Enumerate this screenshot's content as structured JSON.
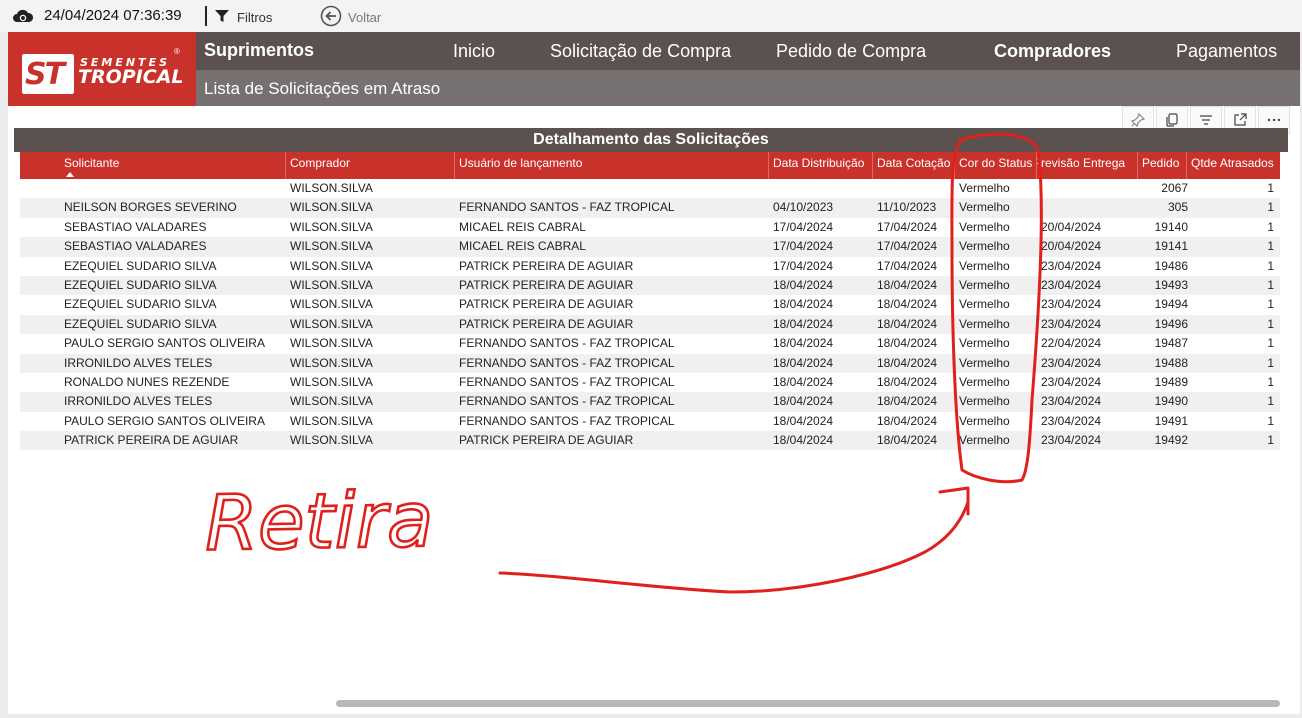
{
  "topbar": {
    "timestamp": "24/04/2024 07:36:39",
    "filters_label": "Filtros",
    "back_label": "Voltar"
  },
  "header": {
    "logo_top": "SEMENTES",
    "logo_bottom": "TROPICAL",
    "logo_mark": "ST",
    "section": "Suprimentos",
    "page_subtitle": "Lista de Solicitações em Atraso",
    "nav": [
      {
        "label": "Inicio",
        "active": false
      },
      {
        "label": "Solicitação de Compra",
        "active": false
      },
      {
        "label": "Pedido de Compra",
        "active": false
      },
      {
        "label": "Compradores",
        "active": true
      },
      {
        "label": "Pagamentos",
        "active": false
      }
    ]
  },
  "table": {
    "title": "Detalhamento das Solicitações",
    "columns": [
      "Solicitante",
      "Comprador",
      "Usuário de lançamento",
      "Data Distribuição",
      "Data Cotação",
      "Cor do Status",
      "Previsão Entrega",
      "Pedido",
      "Qtde Atrasados"
    ],
    "rows": [
      [
        "",
        "WILSON.SILVA",
        "",
        "",
        "",
        "Vermelho",
        "",
        "2067",
        "1"
      ],
      [
        "NEILSON BORGES SEVERINO",
        "WILSON.SILVA",
        "FERNANDO SANTOS - FAZ TROPICAL",
        "04/10/2023",
        "11/10/2023",
        "Vermelho",
        "",
        "305",
        "1"
      ],
      [
        "SEBASTIAO VALADARES",
        "WILSON.SILVA",
        "MICAEL REIS CABRAL",
        "17/04/2024",
        "17/04/2024",
        "Vermelho",
        "20/04/2024",
        "19140",
        "1"
      ],
      [
        "SEBASTIAO VALADARES",
        "WILSON.SILVA",
        "MICAEL REIS CABRAL",
        "17/04/2024",
        "17/04/2024",
        "Vermelho",
        "20/04/2024",
        "19141",
        "1"
      ],
      [
        "EZEQUIEL SUDARIO SILVA",
        "WILSON.SILVA",
        "PATRICK PEREIRA DE AGUIAR",
        "17/04/2024",
        "17/04/2024",
        "Vermelho",
        "23/04/2024",
        "19486",
        "1"
      ],
      [
        "EZEQUIEL SUDARIO SILVA",
        "WILSON.SILVA",
        "PATRICK PEREIRA DE AGUIAR",
        "18/04/2024",
        "18/04/2024",
        "Vermelho",
        "23/04/2024",
        "19493",
        "1"
      ],
      [
        "EZEQUIEL SUDARIO SILVA",
        "WILSON.SILVA",
        "PATRICK PEREIRA DE AGUIAR",
        "18/04/2024",
        "18/04/2024",
        "Vermelho",
        "23/04/2024",
        "19494",
        "1"
      ],
      [
        "EZEQUIEL SUDARIO SILVA",
        "WILSON.SILVA",
        "PATRICK PEREIRA DE AGUIAR",
        "18/04/2024",
        "18/04/2024",
        "Vermelho",
        "23/04/2024",
        "19496",
        "1"
      ],
      [
        "PAULO SERGIO SANTOS OLIVEIRA",
        "WILSON.SILVA",
        "FERNANDO SANTOS - FAZ TROPICAL",
        "18/04/2024",
        "18/04/2024",
        "Vermelho",
        "22/04/2024",
        "19487",
        "1"
      ],
      [
        "IRRONILDO ALVES TELES",
        "WILSON.SILVA",
        "FERNANDO SANTOS - FAZ TROPICAL",
        "18/04/2024",
        "18/04/2024",
        "Vermelho",
        "23/04/2024",
        "19488",
        "1"
      ],
      [
        "RONALDO NUNES REZENDE",
        "WILSON.SILVA",
        "FERNANDO SANTOS - FAZ TROPICAL",
        "18/04/2024",
        "18/04/2024",
        "Vermelho",
        "23/04/2024",
        "19489",
        "1"
      ],
      [
        "IRRONILDO ALVES TELES",
        "WILSON.SILVA",
        "FERNANDO SANTOS - FAZ TROPICAL",
        "18/04/2024",
        "18/04/2024",
        "Vermelho",
        "23/04/2024",
        "19490",
        "1"
      ],
      [
        "PAULO SERGIO SANTOS OLIVEIRA",
        "WILSON.SILVA",
        "FERNANDO SANTOS - FAZ TROPICAL",
        "18/04/2024",
        "18/04/2024",
        "Vermelho",
        "23/04/2024",
        "19491",
        "1"
      ],
      [
        "PATRICK PEREIRA DE AGUIAR",
        "WILSON.SILVA",
        "PATRICK PEREIRA DE AGUIAR",
        "18/04/2024",
        "18/04/2024",
        "Vermelho",
        "23/04/2024",
        "19492",
        "1"
      ]
    ]
  },
  "annotation": {
    "handwritten_text": "Retira",
    "color": "#e0201b"
  },
  "colors": {
    "header_dark": "#5b524f",
    "header_sub": "#767170",
    "brand_red": "#c8322b"
  }
}
